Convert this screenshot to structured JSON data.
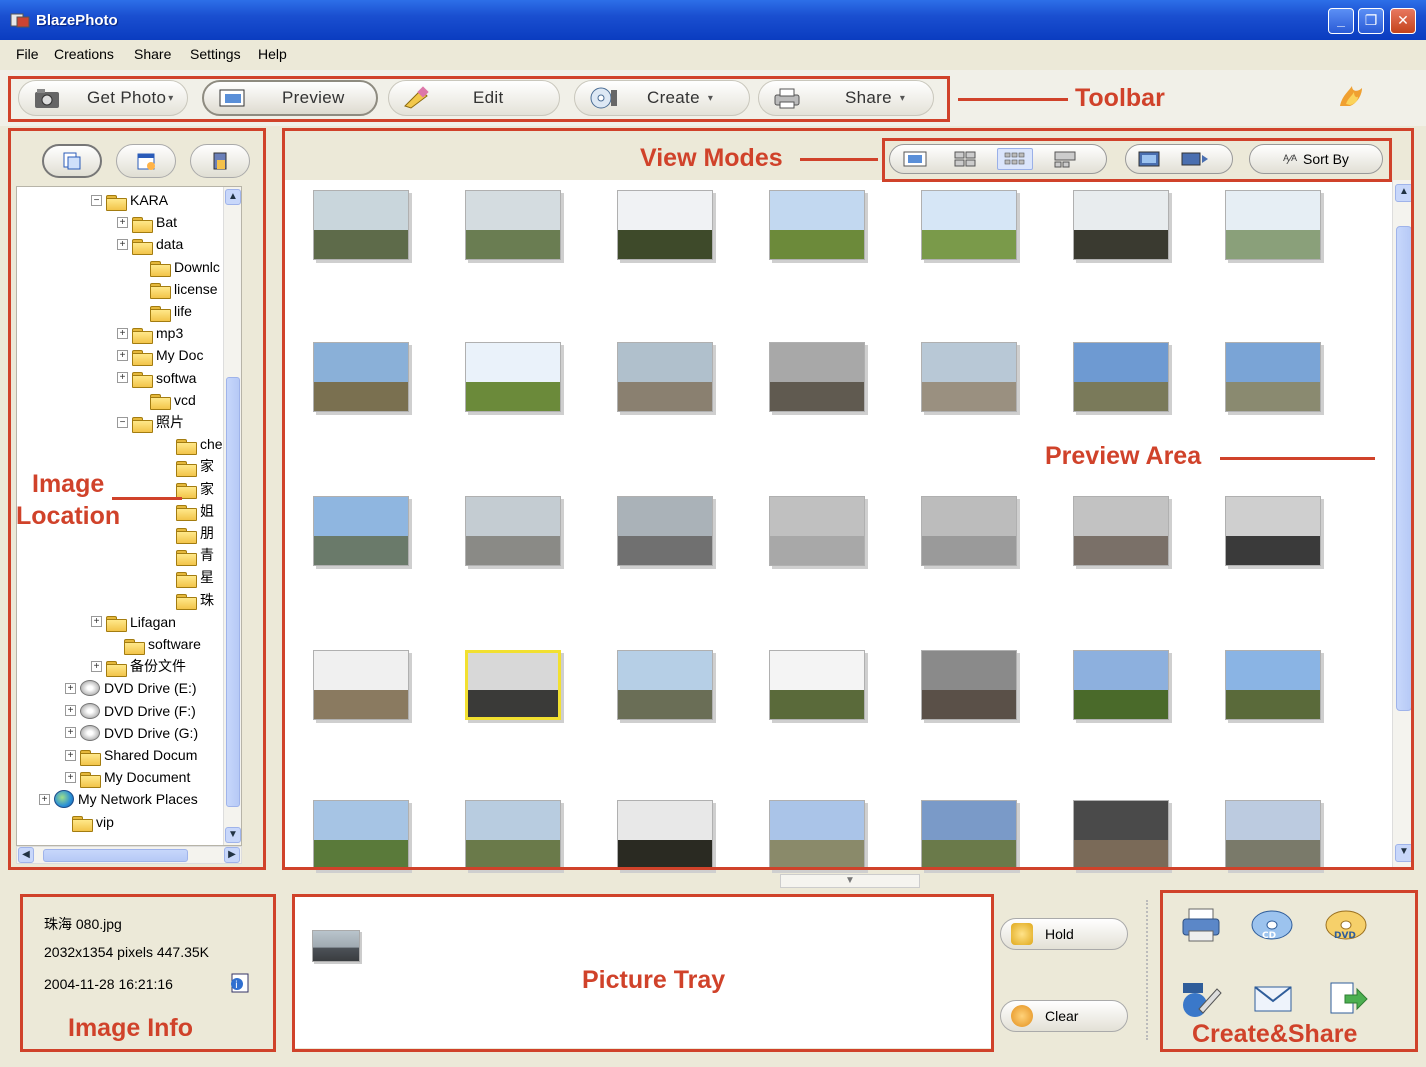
{
  "window": {
    "title": "BlazePhoto"
  },
  "menu": [
    "File",
    "Creations",
    "Share",
    "Settings",
    "Help"
  ],
  "toolbar": {
    "get_photo": "Get Photo",
    "preview": "Preview",
    "edit": "Edit",
    "create": "Create",
    "share": "Share"
  },
  "annotations": {
    "toolbar": "Toolbar",
    "view_modes": "View Modes",
    "image_location_1": "Image",
    "image_location_2": "Location",
    "preview_area": "Preview Area",
    "picture_tray": "Picture Tray",
    "image_info": "Image Info",
    "create_share": "Create&Share"
  },
  "view_modes": {
    "sort_by": "Sort By"
  },
  "tree": [
    "KARA",
    "Bat",
    "data",
    "Downlc",
    "license",
    "life",
    "mp3",
    "My Doc",
    "softwa",
    "vcd",
    "照片",
    "che",
    "家",
    "家",
    "姐",
    "朋",
    "青",
    "星",
    "珠",
    "Lifagan",
    "software",
    "备份文件",
    "DVD Drive (E:)",
    "DVD Drive (F:)",
    "DVD Drive (G:)",
    "Shared Docum",
    "My Document",
    "My Network Places",
    "vip"
  ],
  "image_info": {
    "filename": "珠海 080.jpg",
    "dims": "2032x1354 pixels  447.35K",
    "date": "2004-11-28 16:21:16"
  },
  "tray": {
    "hold": "Hold",
    "clear": "Clear"
  },
  "colors": {
    "annotation": "#d0422a",
    "selection": "#f2e030",
    "titlebar": "#0a3cc0"
  }
}
